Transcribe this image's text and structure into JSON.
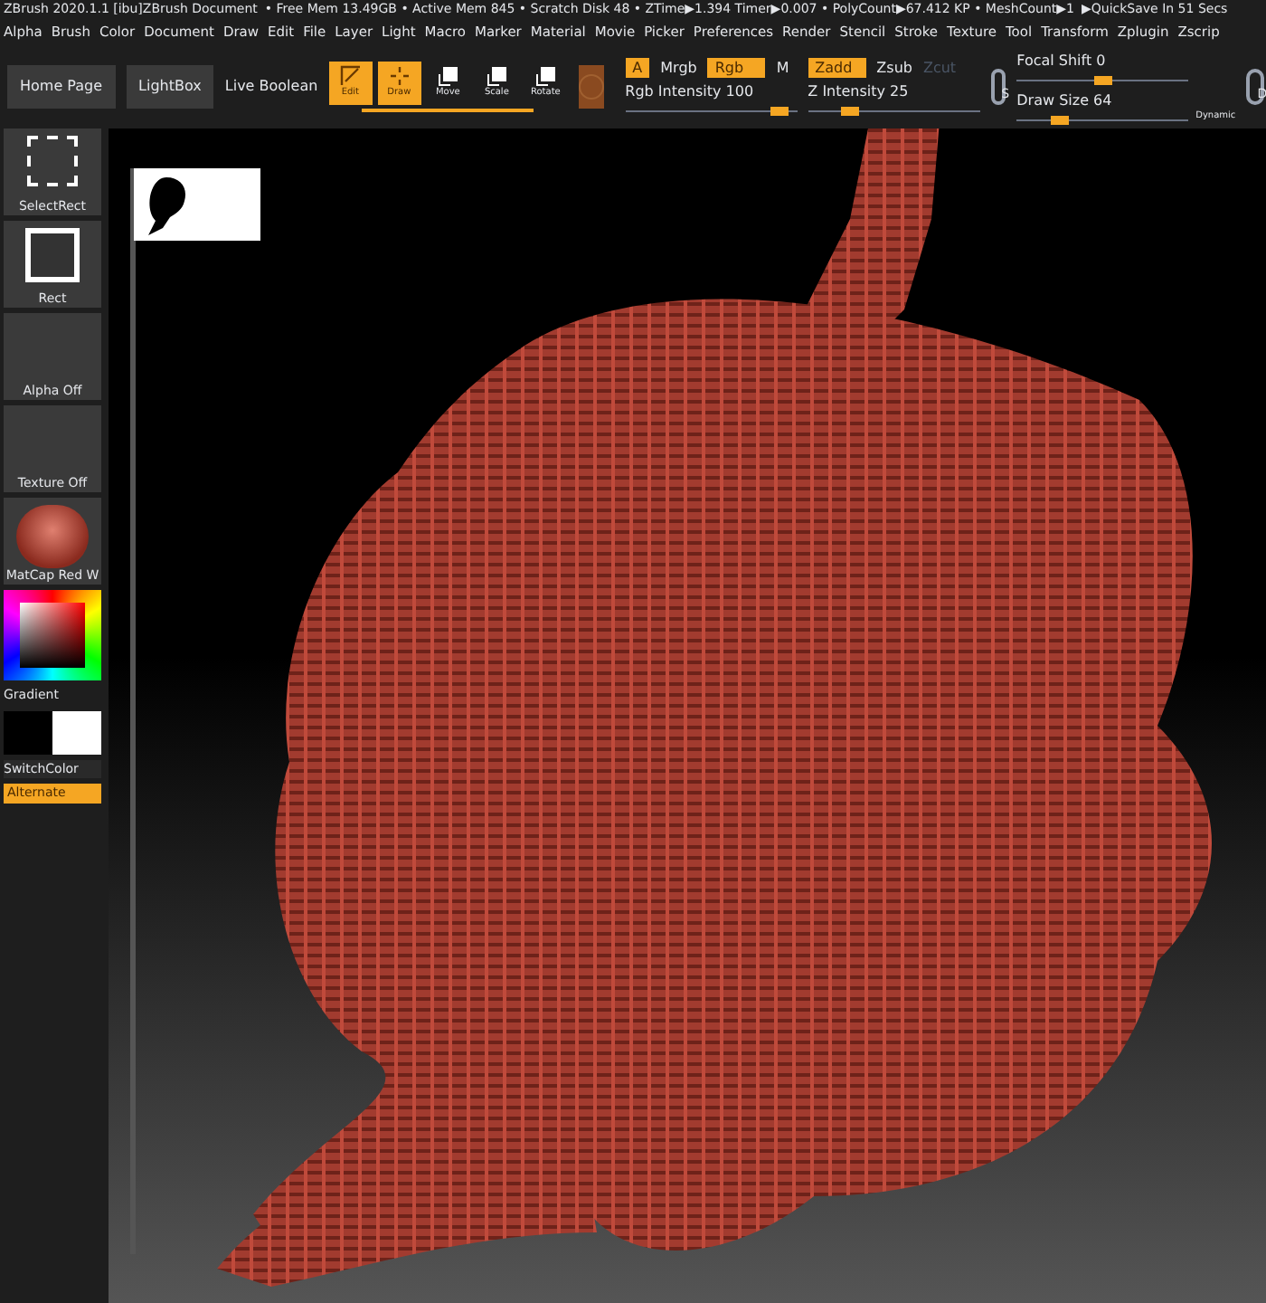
{
  "title_bar": {
    "title": "ZBrush 2020.1.1 [ibu]ZBrush Document",
    "stats": "• Free Mem 13.49GB • Active Mem 845 • Scratch Disk 48 • ZTime▶1.394 Timer▶0.007 • PolyCount▶67.412 KP • MeshCount▶1",
    "quicksave": "▶QuickSave In 51 Secs"
  },
  "menu": [
    "Alpha",
    "Brush",
    "Color",
    "Document",
    "Draw",
    "Edit",
    "File",
    "Layer",
    "Light",
    "Macro",
    "Marker",
    "Material",
    "Movie",
    "Picker",
    "Preferences",
    "Render",
    "Stencil",
    "Stroke",
    "Texture",
    "Tool",
    "Transform",
    "Zplugin",
    "Zscrip"
  ],
  "toolbar": {
    "buttons": [
      {
        "label": "Home Page"
      },
      {
        "label": "LightBox"
      }
    ],
    "live_boolean": "Live Boolean",
    "modes": [
      {
        "label": "Edit",
        "selected": true
      },
      {
        "label": "Draw",
        "selected": true
      },
      {
        "label": "Move",
        "selected": false
      },
      {
        "label": "Scale",
        "selected": false
      },
      {
        "label": "Rotate",
        "selected": false
      }
    ],
    "toggles": [
      {
        "label": "A",
        "on": true
      },
      {
        "label": "Mrgb",
        "on": false
      },
      {
        "label": "Rgb",
        "on": true
      },
      {
        "label": "M",
        "on": false
      },
      {
        "label": "Zadd",
        "on": true
      },
      {
        "label": "Zsub",
        "on": false
      },
      {
        "label": "Zcut",
        "on": false,
        "disabled": true
      }
    ],
    "sliders": [
      {
        "label": "Rgb Intensity 100",
        "level": 0.9
      },
      {
        "label": "Z Intensity 25",
        "level": 0.25
      },
      {
        "label": "Focal Shift 0",
        "level": 0.5
      },
      {
        "label": "Draw Size 64",
        "level": 0.25
      }
    ],
    "dynamic": "Dynamic",
    "s_label": "S",
    "d_label": "D"
  },
  "left_panel": {
    "tiles": [
      {
        "kind": "selectrect",
        "label": "SelectRect"
      },
      {
        "kind": "rect",
        "label": "Rect"
      },
      {
        "kind": "empty",
        "label": "Alpha Off"
      },
      {
        "kind": "empty",
        "label": "Texture Off"
      },
      {
        "kind": "material",
        "label": "MatCap Red W"
      }
    ],
    "gradient": "Gradient",
    "switch_color": "SwitchColor",
    "alternate": {
      "label": "Alternate",
      "on": true
    }
  }
}
